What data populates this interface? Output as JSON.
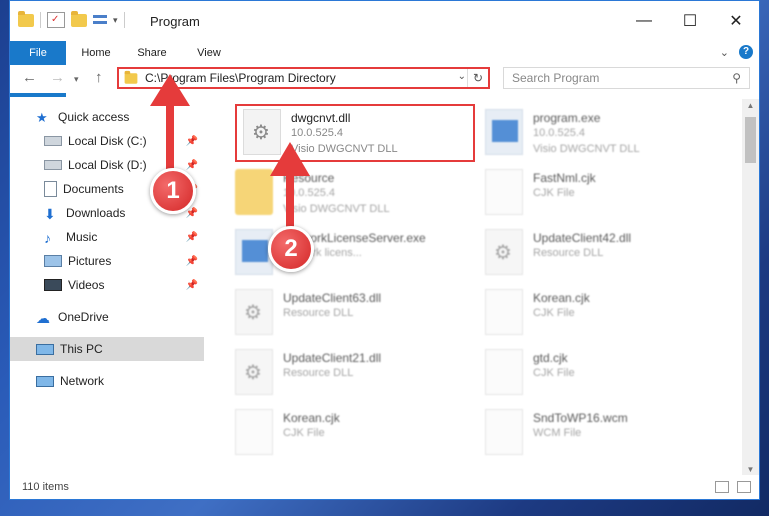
{
  "window": {
    "title": "Program"
  },
  "ribbon": {
    "tabs": [
      "File",
      "Home",
      "Share",
      "View"
    ],
    "file_color": "#1979ca"
  },
  "address_bar": {
    "path": "C:\\Program Files\\Program Directory"
  },
  "search": {
    "placeholder": "Search Program"
  },
  "sidebar": {
    "items": [
      {
        "label": "Quick access",
        "icon": "star-icon"
      },
      {
        "label": "Local Disk (C:)",
        "icon": "drive-icon"
      },
      {
        "label": "Local Disk (D:)",
        "icon": "drive-icon"
      },
      {
        "label": "Documents",
        "icon": "documents-icon"
      },
      {
        "label": "Downloads",
        "icon": "download-icon"
      },
      {
        "label": "Music",
        "icon": "music-icon"
      },
      {
        "label": "Pictures",
        "icon": "pictures-icon"
      },
      {
        "label": "Videos",
        "icon": "videos-icon"
      },
      {
        "label": "OneDrive",
        "icon": "cloud-icon"
      },
      {
        "label": "This PC",
        "icon": "computer-icon"
      },
      {
        "label": "Network",
        "icon": "network-icon"
      }
    ]
  },
  "files": [
    {
      "name": "dwgcnvt.dll",
      "line2": "10.0.525.4",
      "line3": "Visio DWGCNVT DLL",
      "icon": "gear-file-icon"
    },
    {
      "name": "program.exe",
      "line2": "10.0.525.4",
      "line3": "Visio DWGCNVT DLL",
      "icon": "app-icon"
    },
    {
      "name": "Resource",
      "line2": "10.0.525.4",
      "line3": "Visio DWGCNVT DLL",
      "icon": "folder-icon"
    },
    {
      "name": "FastNml.cjk",
      "line2": "CJK File",
      "line3": "",
      "icon": "document-icon"
    },
    {
      "name": "NetworkLicenseServer.exe",
      "line2": "network licens...",
      "line3": "",
      "icon": "app-icon"
    },
    {
      "name": "UpdateClient42.dll",
      "line2": "Resource DLL",
      "line3": "",
      "icon": "gear-file-icon"
    },
    {
      "name": "UpdateClient63.dll",
      "line2": "Resource DLL",
      "line3": "",
      "icon": "gear-file-icon"
    },
    {
      "name": "Korean.cjk",
      "line2": "CJK File",
      "line3": "",
      "icon": "document-icon"
    },
    {
      "name": "UpdateClient21.dll",
      "line2": "Resource DLL",
      "line3": "",
      "icon": "gear-file-icon"
    },
    {
      "name": "gtd.cjk",
      "line2": "CJK File",
      "line3": "",
      "icon": "document-icon"
    },
    {
      "name": "Korean.cjk",
      "line2": "CJK File",
      "line3": "",
      "icon": "document-icon"
    },
    {
      "name": "SndToWP16.wcm",
      "line2": "WCM File",
      "line3": "",
      "icon": "document-icon"
    }
  ],
  "status": {
    "count": "110 items"
  },
  "callouts": {
    "one": "1",
    "two": "2",
    "color": "#e53b3b"
  }
}
